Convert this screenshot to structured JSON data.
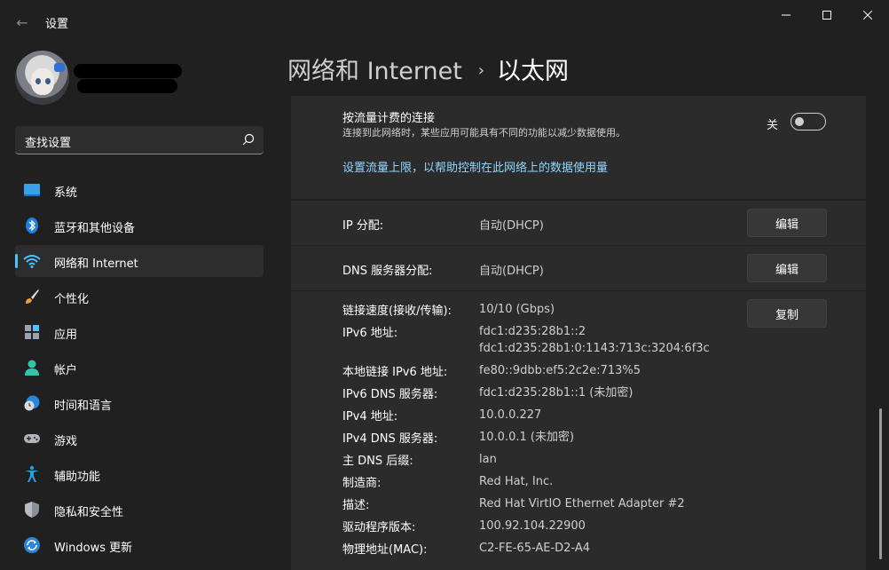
{
  "window": {
    "title": "设置",
    "back_glyph": "←",
    "minimize_glyph": "—",
    "close_glyph": "✕"
  },
  "search": {
    "placeholder": "查找设置"
  },
  "sidebar": {
    "items": [
      {
        "label": "系统",
        "icon": "system-icon"
      },
      {
        "label": "蓝牙和其他设备",
        "icon": "bluetooth-icon"
      },
      {
        "label": "网络和 Internet",
        "icon": "wifi-icon",
        "active": true
      },
      {
        "label": "个性化",
        "icon": "brush-icon"
      },
      {
        "label": "应用",
        "icon": "apps-icon"
      },
      {
        "label": "帐户",
        "icon": "account-icon"
      },
      {
        "label": "时间和语言",
        "icon": "clock-globe-icon"
      },
      {
        "label": "游戏",
        "icon": "gamepad-icon"
      },
      {
        "label": "辅助功能",
        "icon": "accessibility-icon"
      },
      {
        "label": "隐私和安全性",
        "icon": "shield-icon"
      },
      {
        "label": "Windows 更新",
        "icon": "update-icon"
      }
    ]
  },
  "breadcrumb": {
    "parent": "网络和 Internet",
    "separator": "›",
    "current": "以太网"
  },
  "metered": {
    "title": "按流量计费的连接",
    "description": "连接到此网络时，某些应用可能具有不同的功能以减少数据使用。",
    "toggle_state": "关",
    "link": "设置流量上限，以帮助控制在此网络上的数据使用量"
  },
  "ip_assignment": {
    "label": "IP 分配:",
    "value": "自动(DHCP)",
    "button": "编辑"
  },
  "dns_assignment": {
    "label": "DNS 服务器分配:",
    "value": "自动(DHCP)",
    "button": "编辑"
  },
  "copy_button": "复制",
  "properties": [
    {
      "label": "链接速度(接收/传输):",
      "value": "10/10 (Gbps)"
    },
    {
      "label": "IPv6 地址:",
      "value": "fdc1:d235:28b1::2",
      "value2": "fdc1:d235:28b1:0:1143:713c:3204:6f3c"
    },
    {
      "label": "本地链接 IPv6 地址:",
      "value": "fe80::9dbb:ef5:2c2e:713%5"
    },
    {
      "label": "IPv6 DNS 服务器:",
      "value": "fdc1:d235:28b1::1 (未加密)"
    },
    {
      "label": "IPv4 地址:",
      "value": "10.0.0.227"
    },
    {
      "label": "IPv4 DNS 服务器:",
      "value": "10.0.0.1 (未加密)"
    },
    {
      "label": "主 DNS 后缀:",
      "value": "lan"
    },
    {
      "label": "制造商:",
      "value": "Red Hat, Inc."
    },
    {
      "label": "描述:",
      "value": "Red Hat VirtIO Ethernet Adapter #2"
    },
    {
      "label": "驱动程序版本:",
      "value": "100.92.104.22900"
    },
    {
      "label": "物理地址(MAC):",
      "value": "C2-FE-65-AE-D2-A4"
    }
  ],
  "colors": {
    "accent": "#4cc2ff",
    "link": "#8fd7ff",
    "background": "#202020",
    "card": "#2b2b2b"
  }
}
